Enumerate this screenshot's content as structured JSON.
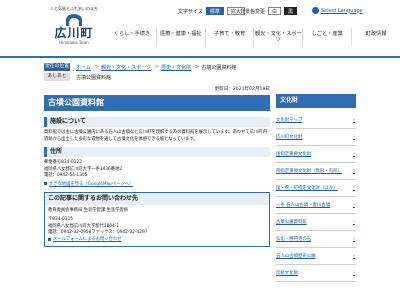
{
  "header": {
    "tagline": "人と気風とふれあいのまち",
    "town_name": "広川町",
    "town_roman": "Hirokawa Town",
    "font_size_label": "文字サイズ",
    "font_std": "標準",
    "font_large": "拡大",
    "bg_color_label": "背景色変更",
    "bg_white": "白",
    "bg_black": "黒",
    "lang_label": "Select Language"
  },
  "gnav": [
    "くらし・手続き",
    "医療・健康・福祉",
    "子育て・教育",
    "観光・文化・スポーツ",
    "しごと・産業",
    "町政情報"
  ],
  "breadcrumb": {
    "now_tag": "現在の位置",
    "items": [
      "ホーム",
      "観光・文化・スポーツ",
      "歴史・文化財",
      "古墳公園資料館"
    ],
    "here_tag": "あしあと",
    "here_items": [
      "古墳公園資料館"
    ]
  },
  "main": {
    "updated": "更新日：2021年02月18日",
    "title": "古墳公園資料館",
    "about_heading": "施設について",
    "about_text": "資料館では主に古墳公園内にある石人山古墳など広川町を理解する為の資料館を展示しています。あわせて広川町内遺跡から出土した多彩な遺物を通して古墳文化を体感できる場となっています。",
    "address_heading": "住所",
    "address_lines": [
      "郵便番号834-0122",
      "福岡県八女郡広川町大字一条1436番地2",
      "電話：0942-54-1305"
    ],
    "map_link": "大きな地図を見る（GoogleMapページへ）",
    "inquiry_heading": "この記事に関するお問い合わせ先",
    "inquiry_dept": "教育委員会事務局 生涯学習課 生涯学習係",
    "inquiry_lines": [
      "〒834-0115",
      "福岡県八女郡広川町大字新代1804-1",
      "電話：0942-32-0958ファックス：0942-32-4297"
    ],
    "mail_link": "メールフォームによるお問い合わせ"
  },
  "sidebar": {
    "heading": "文化財",
    "items": [
      "文化財マップ",
      "広川町文化財",
      "国指定重要文化財",
      "県指定重要文化財（無形・有形）",
      "国・県・町指定文化財（ほか）",
      "一条 石人山古墳・妻川古墳",
      "古墳公園資料館",
      "弘化・慈円寺の石",
      "石人山古墳歴史公園",
      "伝統文化財"
    ]
  }
}
